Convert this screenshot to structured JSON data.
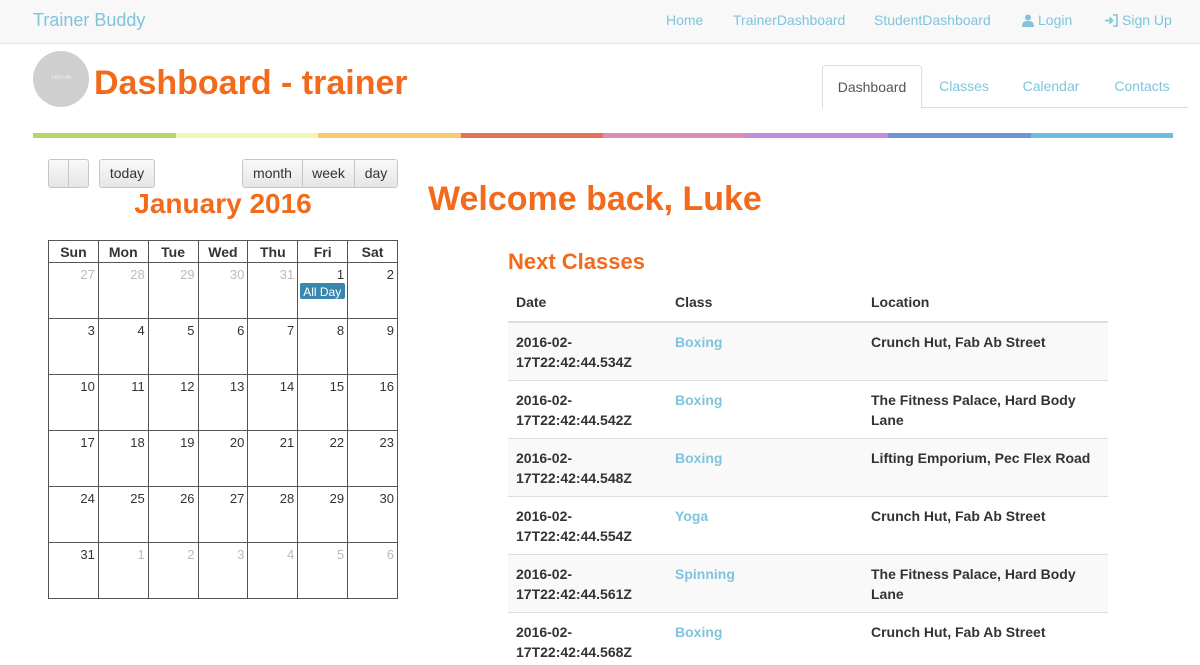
{
  "nav": {
    "brand": "Trainer Buddy",
    "links": [
      "Home",
      "TrainerDashboard",
      "StudentDashboard"
    ],
    "login": "Login",
    "signup": "Sign Up"
  },
  "header": {
    "avatar_text": "140×140",
    "title": "Dashboard - trainer",
    "tabs": [
      "Dashboard",
      "Classes",
      "Calendar",
      "Contacts"
    ]
  },
  "colors": {
    "accent": "#f26b1d",
    "link": "#7fc4dc",
    "rainbow": [
      "#b5d56a",
      "#eef7b4",
      "#fbc86a",
      "#e6705a",
      "#dd8cbc",
      "#c08ddc",
      "#6b95d6",
      "#68bfe0"
    ]
  },
  "calendar": {
    "buttons": {
      "today": "today",
      "month": "month",
      "week": "week",
      "day": "day"
    },
    "title": "January 2016",
    "weekdays": [
      "Sun",
      "Mon",
      "Tue",
      "Wed",
      "Thu",
      "Fri",
      "Sat"
    ],
    "weeks": [
      [
        "27",
        "28",
        "29",
        "30",
        "31",
        "1",
        "2"
      ],
      [
        "3",
        "4",
        "5",
        "6",
        "7",
        "8",
        "9"
      ],
      [
        "10",
        "11",
        "12",
        "13",
        "14",
        "15",
        "16"
      ],
      [
        "17",
        "18",
        "19",
        "20",
        "21",
        "22",
        "23"
      ],
      [
        "24",
        "25",
        "26",
        "27",
        "28",
        "29",
        "30"
      ],
      [
        "31",
        "1",
        "2",
        "3",
        "4",
        "5",
        "6"
      ]
    ],
    "event_label": "All Day"
  },
  "welcome": "Welcome back, Luke",
  "next_classes": {
    "title": "Next Classes",
    "headers": [
      "Date",
      "Class",
      "Location"
    ],
    "rows": [
      {
        "date_a": "2016-02-",
        "date_b": "17T22:42:44.534Z",
        "class": "Boxing",
        "loc_a": "Crunch Hut, Fab Ab Street",
        "loc_b": ""
      },
      {
        "date_a": "2016-02-",
        "date_b": "17T22:42:44.542Z",
        "class": "Boxing",
        "loc_a": "The Fitness Palace, Hard Body",
        "loc_b": "Lane"
      },
      {
        "date_a": "2016-02-",
        "date_b": "17T22:42:44.548Z",
        "class": "Boxing",
        "loc_a": "Lifting Emporium, Pec Flex Road",
        "loc_b": ""
      },
      {
        "date_a": "2016-02-",
        "date_b": "17T22:42:44.554Z",
        "class": "Yoga",
        "loc_a": "Crunch Hut, Fab Ab Street",
        "loc_b": ""
      },
      {
        "date_a": "2016-02-",
        "date_b": "17T22:42:44.561Z",
        "class": "Spinning",
        "loc_a": "The Fitness Palace, Hard Body",
        "loc_b": "Lane"
      },
      {
        "date_a": "2016-02-",
        "date_b": "17T22:42:44.568Z",
        "class": "Boxing",
        "loc_a": "Crunch Hut, Fab Ab Street",
        "loc_b": ""
      }
    ]
  }
}
